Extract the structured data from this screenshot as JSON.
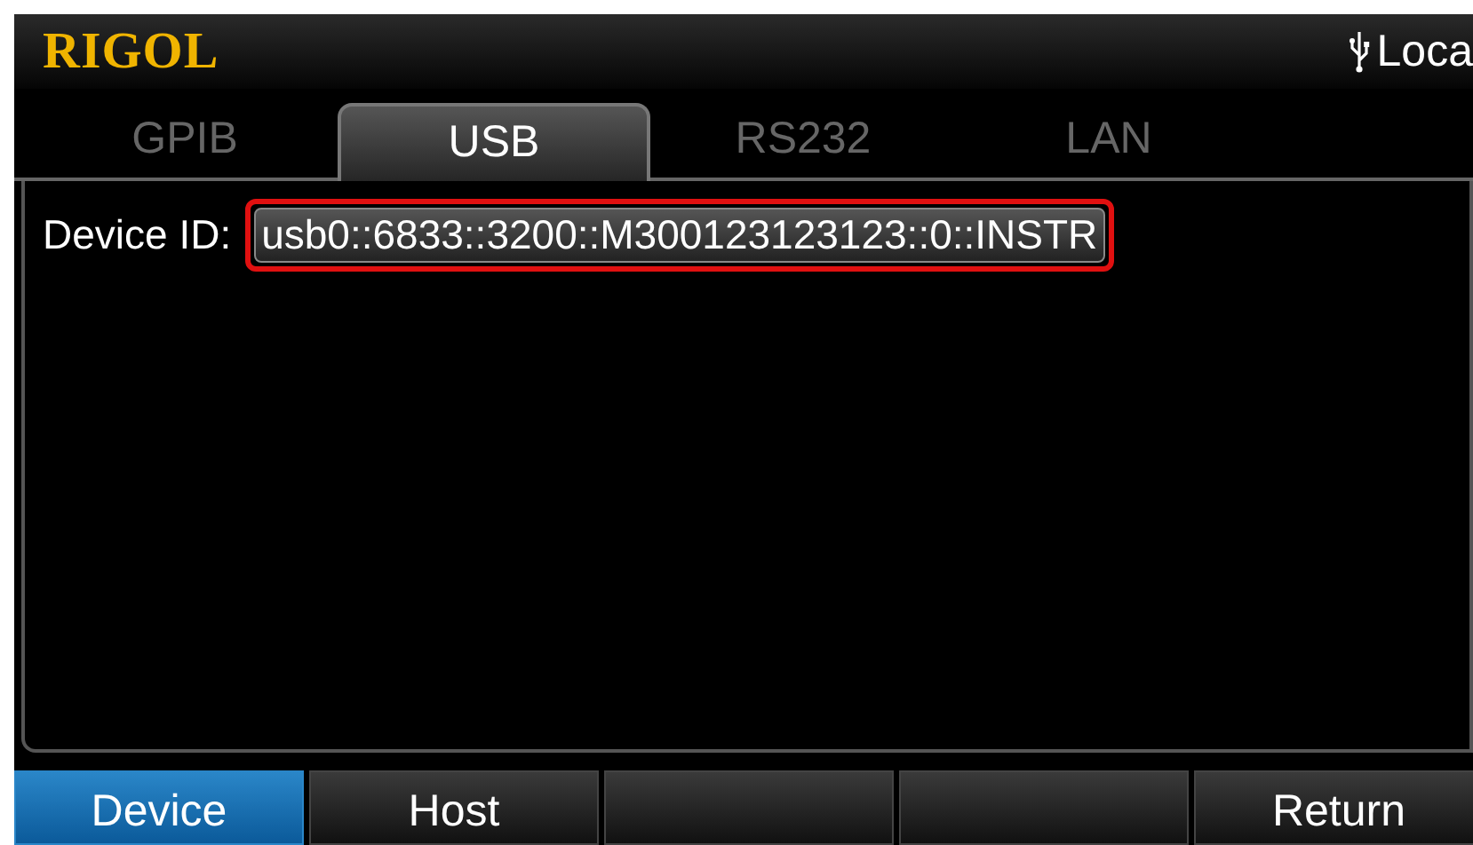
{
  "header": {
    "logo": "RIGOL",
    "status": "Loca"
  },
  "tabs": [
    {
      "label": "GPIB",
      "selected": false
    },
    {
      "label": "USB",
      "selected": true
    },
    {
      "label": "RS232",
      "selected": false
    },
    {
      "label": "LAN",
      "selected": false
    }
  ],
  "device_id": {
    "label": "Device ID:",
    "value": "usb0::6833::3200::M300123123123::0::INSTR",
    "highlighted": true
  },
  "softkeys": [
    {
      "label": "Device",
      "selected": true
    },
    {
      "selected": false,
      "label": "Host"
    },
    {
      "selected": false
    },
    {
      "selected": false
    },
    {
      "selected": false,
      "label": "Return"
    }
  ]
}
